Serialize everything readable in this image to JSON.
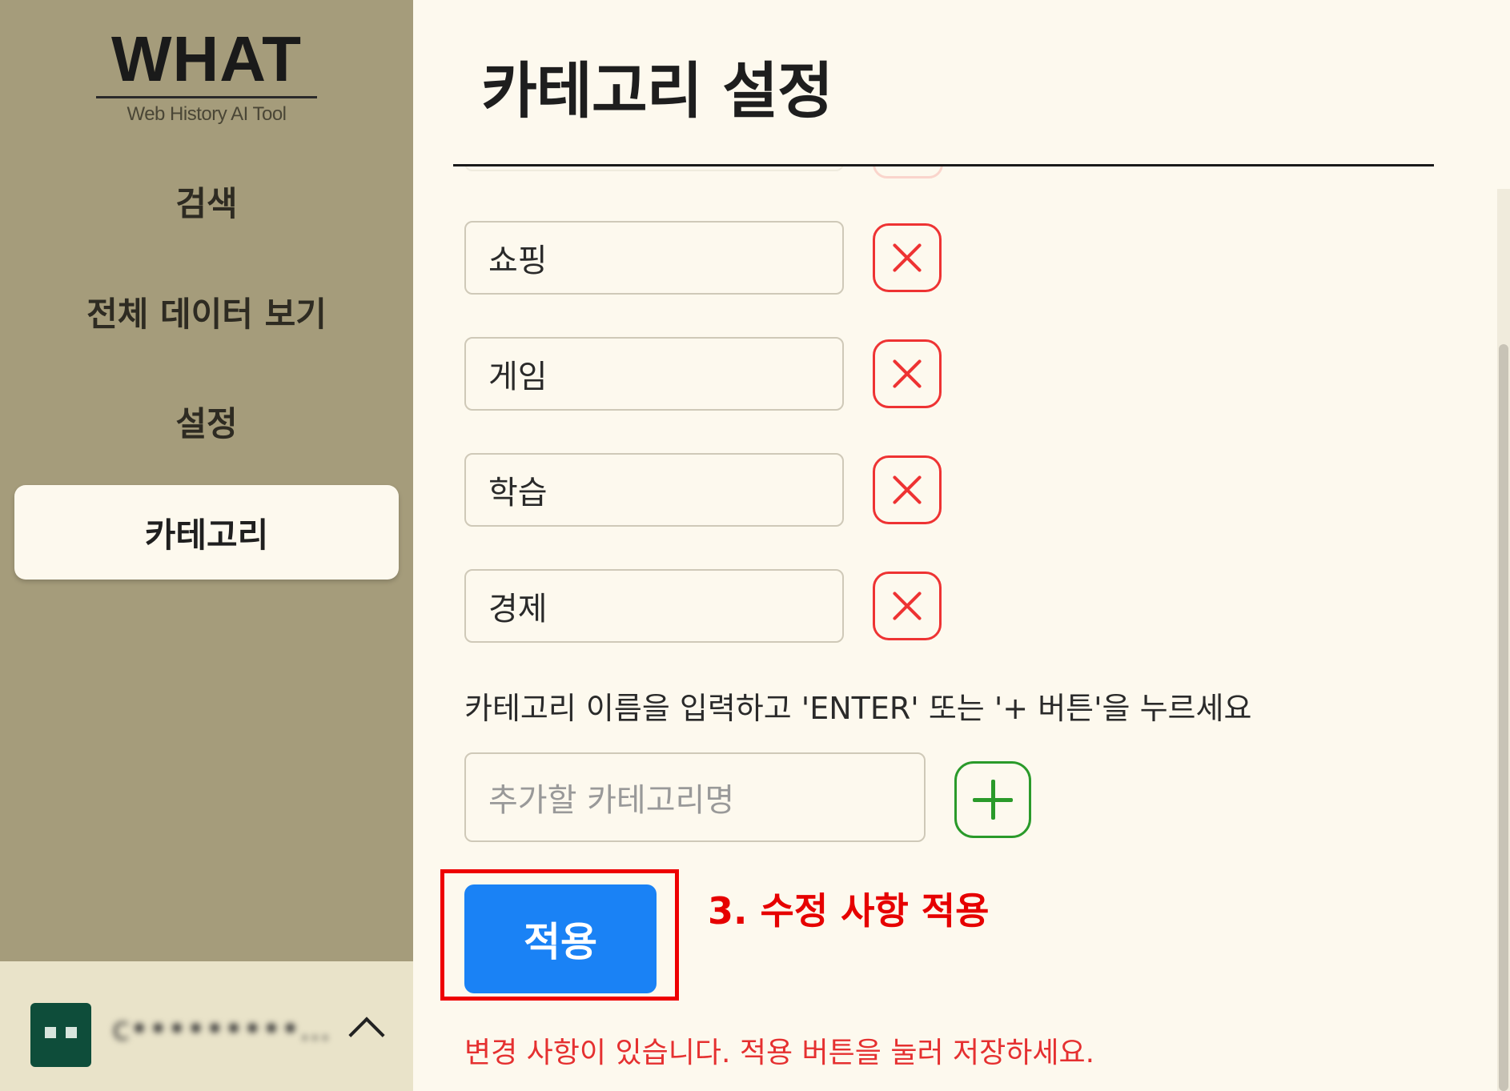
{
  "sidebar": {
    "logo_title": "WHAT",
    "logo_subtitle": "Web History AI Tool",
    "nav": [
      {
        "label": "검색"
      },
      {
        "label": "전체 데이터 보기"
      },
      {
        "label": "설정"
      },
      {
        "label": "카테고리",
        "active": true
      }
    ],
    "user": {
      "name": "c•••••••••..."
    }
  },
  "main": {
    "title": "카테고리 설정",
    "categories": [
      "쇼핑",
      "게임",
      "학습",
      "경제"
    ],
    "hint": "카테고리 이름을 입력하고 'ENTER' 또는 '+ 버튼'을 누르세요",
    "add_placeholder": "추가할 카테고리명",
    "apply_label": "적용",
    "annotation": "3. 수정 사항 적용",
    "warning": "변경 사항이 있습니다. 적용 버튼을 눌러 저장하세요."
  },
  "colors": {
    "sidebar_bg": "#a59c7b",
    "main_bg": "#fdf9ee",
    "accent_blue": "#1a82f5",
    "delete_red": "#e33333",
    "add_green": "#2a9a2a",
    "annotation_red": "#e60000"
  },
  "icons": {
    "delete": "close-icon",
    "add": "plus-icon",
    "expand": "chevron-up-icon"
  }
}
